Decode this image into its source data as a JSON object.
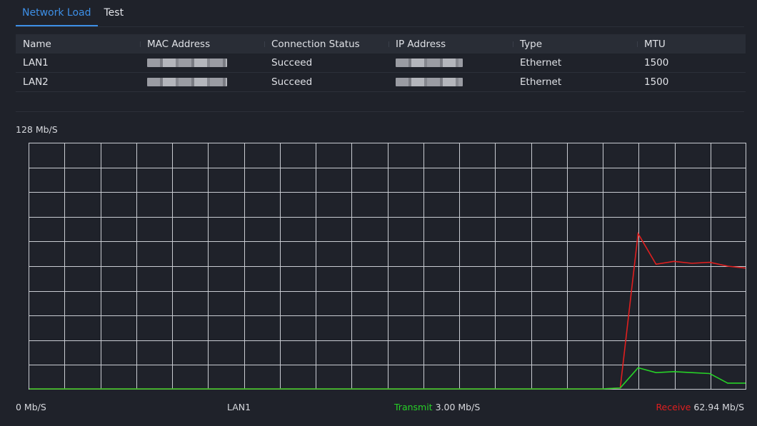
{
  "tabs": [
    {
      "label": "Network Load",
      "active": true
    },
    {
      "label": "Test",
      "active": false
    }
  ],
  "table": {
    "headers": [
      "Name",
      "MAC Address",
      "Connection Status",
      "IP Address",
      "Type",
      "MTU"
    ],
    "rows": [
      {
        "name": "LAN1",
        "mac": "",
        "status": "Succeed",
        "ip": "",
        "type": "Ethernet",
        "mtu": "1500"
      },
      {
        "name": "LAN2",
        "mac": "",
        "status": "Succeed",
        "ip": "",
        "type": "Ethernet",
        "mtu": "1500"
      }
    ]
  },
  "graph": {
    "y_max_label": "128 Mb/S",
    "y_min_label": "0 Mb/S",
    "interface": "LAN1",
    "transmit_label": "Transmit",
    "transmit_value": "3.00 Mb/S",
    "receive_label": "Receive",
    "receive_value": "62.94 Mb/S",
    "colors": {
      "transmit": "#27d127",
      "receive": "#e01f1f",
      "grid": "#c9ccd2"
    }
  },
  "chart_data": {
    "type": "line",
    "ylim": [
      0,
      128
    ],
    "grid": true,
    "x": [
      0,
      1,
      2,
      3,
      4,
      5,
      6,
      7,
      8,
      9,
      10,
      11,
      12,
      13,
      14,
      15,
      16,
      17,
      18,
      19,
      20,
      21,
      22,
      23,
      24,
      25,
      26,
      27,
      28,
      29,
      30,
      31,
      32,
      33,
      34,
      35,
      36,
      37,
      38,
      39,
      40
    ],
    "series": [
      {
        "name": "Receive",
        "color": "#e01f1f",
        "values": [
          0,
          0,
          0,
          0,
          0,
          0,
          0,
          0,
          0,
          0,
          0,
          0,
          0,
          0,
          0,
          0,
          0,
          0,
          0,
          0,
          0,
          0,
          0,
          0,
          0,
          0,
          0,
          0,
          0,
          0,
          0,
          0,
          0,
          0.5,
          81,
          65,
          66.5,
          65.5,
          66,
          64,
          63
        ]
      },
      {
        "name": "Transmit",
        "color": "#27d127",
        "values": [
          0,
          0,
          0,
          0,
          0,
          0,
          0,
          0,
          0,
          0,
          0,
          0,
          0,
          0,
          0,
          0,
          0,
          0,
          0,
          0,
          0,
          0,
          0,
          0,
          0,
          0,
          0,
          0,
          0,
          0,
          0,
          0,
          0,
          0.5,
          11,
          8.5,
          9,
          8.5,
          8,
          3,
          3
        ]
      }
    ]
  }
}
